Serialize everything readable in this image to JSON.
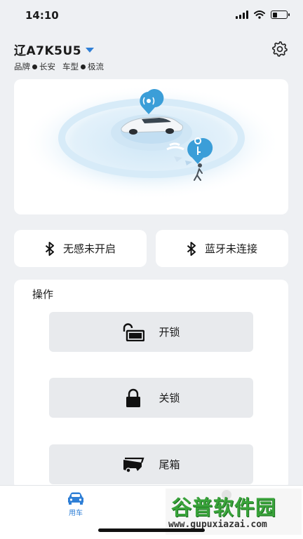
{
  "status_bar": {
    "time": "14:10",
    "battery_level": 0.3
  },
  "car": {
    "name": "辽A7K5U5",
    "brand_label": "品牌",
    "brand_value": "长安",
    "model_label": "车型",
    "model_value": "极流"
  },
  "quick_status": [
    {
      "label": "无感未开启",
      "icon": "bluetooth-icon"
    },
    {
      "label": "蓝牙未连接",
      "icon": "bluetooth-icon"
    }
  ],
  "operations": {
    "title": "操作",
    "buttons": [
      {
        "label": "开锁",
        "icon": "unlock-icon"
      },
      {
        "label": "关锁",
        "icon": "lock-icon"
      },
      {
        "label": "尾箱",
        "icon": "trunk-icon"
      }
    ]
  },
  "tab_bar": {
    "car_tab_label": "用车"
  },
  "watermark": {
    "title": "谷普软件园",
    "url": "www.gupuxiazai.com"
  },
  "colors": {
    "accent": "#2f7fd6",
    "background": "#eef0f3",
    "button_bg": "#e8eaed",
    "watermark_green": "#39a33a"
  }
}
